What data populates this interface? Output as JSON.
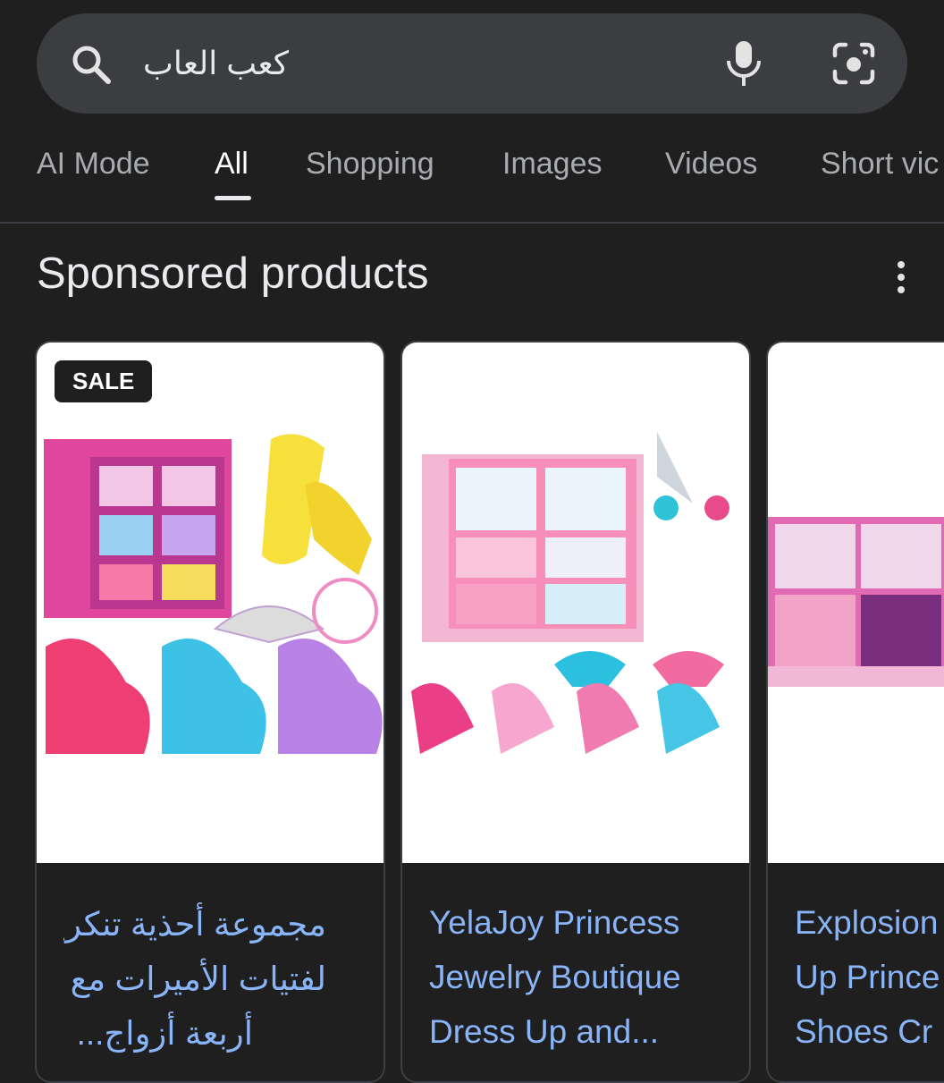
{
  "search": {
    "query": "كعب العاب"
  },
  "tabs": [
    "AI Mode",
    "All",
    "Shopping",
    "Images",
    "Videos",
    "Short vic"
  ],
  "section": {
    "title": "Sponsored products"
  },
  "products": [
    {
      "badge": "SALE",
      "title_lines": [
        "مجموعة أحذية تنكرية",
        "لفتيات الأميرات مع",
        "أربعة أزواج..."
      ]
    },
    {
      "title_lines": [
        "YelaJoy Princess",
        "Jewelry Boutique",
        "Dress Up and..."
      ]
    },
    {
      "title_lines": [
        "Explosion",
        "Up Prince",
        "Shoes Cr"
      ]
    }
  ],
  "colors": {
    "background": "#1f1f1f",
    "searchbar": "#3c3d40",
    "link": "#8ab4f8"
  },
  "icons": [
    "search-icon",
    "mic-icon",
    "lens-icon",
    "more-vert-icon"
  ]
}
